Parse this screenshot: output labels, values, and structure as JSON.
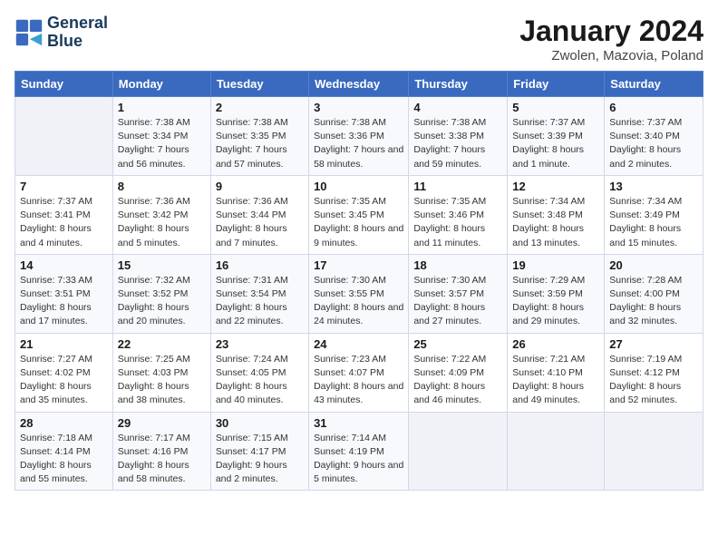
{
  "logo": {
    "line1": "General",
    "line2": "Blue"
  },
  "title": "January 2024",
  "location": "Zwolen, Mazovia, Poland",
  "headers": [
    "Sunday",
    "Monday",
    "Tuesday",
    "Wednesday",
    "Thursday",
    "Friday",
    "Saturday"
  ],
  "weeks": [
    [
      {
        "num": "",
        "sunrise": "",
        "sunset": "",
        "daylight": ""
      },
      {
        "num": "1",
        "sunrise": "Sunrise: 7:38 AM",
        "sunset": "Sunset: 3:34 PM",
        "daylight": "Daylight: 7 hours and 56 minutes."
      },
      {
        "num": "2",
        "sunrise": "Sunrise: 7:38 AM",
        "sunset": "Sunset: 3:35 PM",
        "daylight": "Daylight: 7 hours and 57 minutes."
      },
      {
        "num": "3",
        "sunrise": "Sunrise: 7:38 AM",
        "sunset": "Sunset: 3:36 PM",
        "daylight": "Daylight: 7 hours and 58 minutes."
      },
      {
        "num": "4",
        "sunrise": "Sunrise: 7:38 AM",
        "sunset": "Sunset: 3:38 PM",
        "daylight": "Daylight: 7 hours and 59 minutes."
      },
      {
        "num": "5",
        "sunrise": "Sunrise: 7:37 AM",
        "sunset": "Sunset: 3:39 PM",
        "daylight": "Daylight: 8 hours and 1 minute."
      },
      {
        "num": "6",
        "sunrise": "Sunrise: 7:37 AM",
        "sunset": "Sunset: 3:40 PM",
        "daylight": "Daylight: 8 hours and 2 minutes."
      }
    ],
    [
      {
        "num": "7",
        "sunrise": "Sunrise: 7:37 AM",
        "sunset": "Sunset: 3:41 PM",
        "daylight": "Daylight: 8 hours and 4 minutes."
      },
      {
        "num": "8",
        "sunrise": "Sunrise: 7:36 AM",
        "sunset": "Sunset: 3:42 PM",
        "daylight": "Daylight: 8 hours and 5 minutes."
      },
      {
        "num": "9",
        "sunrise": "Sunrise: 7:36 AM",
        "sunset": "Sunset: 3:44 PM",
        "daylight": "Daylight: 8 hours and 7 minutes."
      },
      {
        "num": "10",
        "sunrise": "Sunrise: 7:35 AM",
        "sunset": "Sunset: 3:45 PM",
        "daylight": "Daylight: 8 hours and 9 minutes."
      },
      {
        "num": "11",
        "sunrise": "Sunrise: 7:35 AM",
        "sunset": "Sunset: 3:46 PM",
        "daylight": "Daylight: 8 hours and 11 minutes."
      },
      {
        "num": "12",
        "sunrise": "Sunrise: 7:34 AM",
        "sunset": "Sunset: 3:48 PM",
        "daylight": "Daylight: 8 hours and 13 minutes."
      },
      {
        "num": "13",
        "sunrise": "Sunrise: 7:34 AM",
        "sunset": "Sunset: 3:49 PM",
        "daylight": "Daylight: 8 hours and 15 minutes."
      }
    ],
    [
      {
        "num": "14",
        "sunrise": "Sunrise: 7:33 AM",
        "sunset": "Sunset: 3:51 PM",
        "daylight": "Daylight: 8 hours and 17 minutes."
      },
      {
        "num": "15",
        "sunrise": "Sunrise: 7:32 AM",
        "sunset": "Sunset: 3:52 PM",
        "daylight": "Daylight: 8 hours and 20 minutes."
      },
      {
        "num": "16",
        "sunrise": "Sunrise: 7:31 AM",
        "sunset": "Sunset: 3:54 PM",
        "daylight": "Daylight: 8 hours and 22 minutes."
      },
      {
        "num": "17",
        "sunrise": "Sunrise: 7:30 AM",
        "sunset": "Sunset: 3:55 PM",
        "daylight": "Daylight: 8 hours and 24 minutes."
      },
      {
        "num": "18",
        "sunrise": "Sunrise: 7:30 AM",
        "sunset": "Sunset: 3:57 PM",
        "daylight": "Daylight: 8 hours and 27 minutes."
      },
      {
        "num": "19",
        "sunrise": "Sunrise: 7:29 AM",
        "sunset": "Sunset: 3:59 PM",
        "daylight": "Daylight: 8 hours and 29 minutes."
      },
      {
        "num": "20",
        "sunrise": "Sunrise: 7:28 AM",
        "sunset": "Sunset: 4:00 PM",
        "daylight": "Daylight: 8 hours and 32 minutes."
      }
    ],
    [
      {
        "num": "21",
        "sunrise": "Sunrise: 7:27 AM",
        "sunset": "Sunset: 4:02 PM",
        "daylight": "Daylight: 8 hours and 35 minutes."
      },
      {
        "num": "22",
        "sunrise": "Sunrise: 7:25 AM",
        "sunset": "Sunset: 4:03 PM",
        "daylight": "Daylight: 8 hours and 38 minutes."
      },
      {
        "num": "23",
        "sunrise": "Sunrise: 7:24 AM",
        "sunset": "Sunset: 4:05 PM",
        "daylight": "Daylight: 8 hours and 40 minutes."
      },
      {
        "num": "24",
        "sunrise": "Sunrise: 7:23 AM",
        "sunset": "Sunset: 4:07 PM",
        "daylight": "Daylight: 8 hours and 43 minutes."
      },
      {
        "num": "25",
        "sunrise": "Sunrise: 7:22 AM",
        "sunset": "Sunset: 4:09 PM",
        "daylight": "Daylight: 8 hours and 46 minutes."
      },
      {
        "num": "26",
        "sunrise": "Sunrise: 7:21 AM",
        "sunset": "Sunset: 4:10 PM",
        "daylight": "Daylight: 8 hours and 49 minutes."
      },
      {
        "num": "27",
        "sunrise": "Sunrise: 7:19 AM",
        "sunset": "Sunset: 4:12 PM",
        "daylight": "Daylight: 8 hours and 52 minutes."
      }
    ],
    [
      {
        "num": "28",
        "sunrise": "Sunrise: 7:18 AM",
        "sunset": "Sunset: 4:14 PM",
        "daylight": "Daylight: 8 hours and 55 minutes."
      },
      {
        "num": "29",
        "sunrise": "Sunrise: 7:17 AM",
        "sunset": "Sunset: 4:16 PM",
        "daylight": "Daylight: 8 hours and 58 minutes."
      },
      {
        "num": "30",
        "sunrise": "Sunrise: 7:15 AM",
        "sunset": "Sunset: 4:17 PM",
        "daylight": "Daylight: 9 hours and 2 minutes."
      },
      {
        "num": "31",
        "sunrise": "Sunrise: 7:14 AM",
        "sunset": "Sunset: 4:19 PM",
        "daylight": "Daylight: 9 hours and 5 minutes."
      },
      {
        "num": "",
        "sunrise": "",
        "sunset": "",
        "daylight": ""
      },
      {
        "num": "",
        "sunrise": "",
        "sunset": "",
        "daylight": ""
      },
      {
        "num": "",
        "sunrise": "",
        "sunset": "",
        "daylight": ""
      }
    ]
  ]
}
